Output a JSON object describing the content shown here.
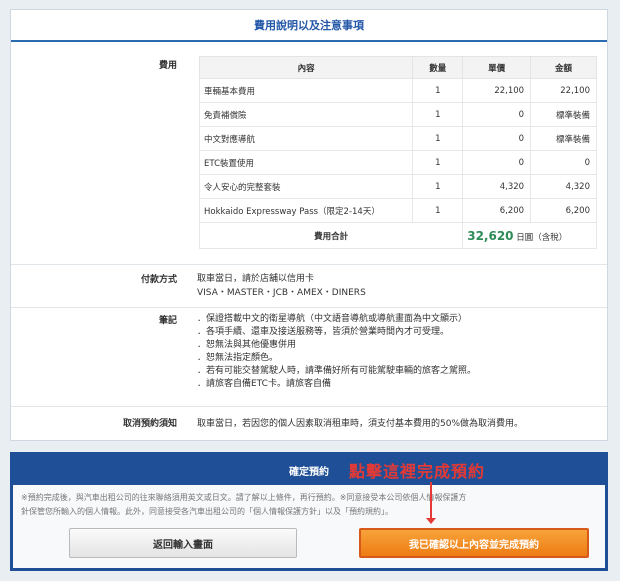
{
  "section_title": "費用說明以及注意事項",
  "fee_label": "費用",
  "fee_table": {
    "headers": [
      "內容",
      "數量",
      "單價",
      "金額"
    ],
    "rows": [
      [
        "車輛基本費用",
        "1",
        "22,100",
        "22,100"
      ],
      [
        "免責補償險",
        "1",
        "0",
        "標準裝備"
      ],
      [
        "中文對應導航",
        "1",
        "0",
        "標準裝備"
      ],
      [
        "ETC裝置使用",
        "1",
        "0",
        "0"
      ],
      [
        "令人安心的完整套裝",
        "1",
        "4,320",
        "4,320"
      ],
      [
        "Hokkaido Expressway Pass（限定2-14天）",
        "1",
        "6,200",
        "6,200"
      ]
    ],
    "total_label": "費用合計",
    "total_amount": "32,620",
    "total_unit": "日圓（含稅）"
  },
  "payment": {
    "label": "付款方式",
    "line1": "取車當日，請於店舖以信用卡",
    "line2": "VISA・MASTER・JCB・AMEX・DINERS"
  },
  "notes": {
    "label": "筆記",
    "items": [
      "．保證搭載中文的衛星導航（中文語音導航或導航畫面為中文顯示）",
      "．各項手續、還車及接送服務等，皆須於營業時間內才可受理。",
      "．恕無法與其他優惠併用",
      "．恕無法指定顏色。",
      "．若有可能交替駕駛人時，請準備好所有可能駕駛車輛的旅客之駕照。",
      "．請旅客自備ETC卡。請旅客自備"
    ]
  },
  "cancel": {
    "label": "取消預約須知",
    "text": "取車當日，若因您的個人因素取消租車時，須支付基本費用的50%做為取消費用。"
  },
  "confirm": {
    "title": "確定預約",
    "annotation": "點擊這裡完成預約",
    "notice_line1": "※預約完成後，與汽車出租公司的往來聯絡須用英文或日文。請了解以上條件，再行預約。※同意接受本公司依個人情報保護方",
    "notice_line2": "針保管您所輸入的個人情報。此外，同意接受各汽車出租公司的「個人情報保護方針」以及「預約規約」。",
    "back_label": "返回輸入畫面",
    "submit_label": "我已確認以上內容並完成預約"
  }
}
